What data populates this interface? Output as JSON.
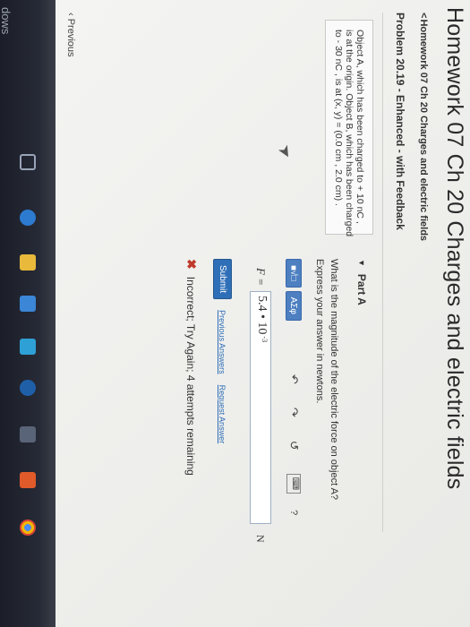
{
  "os": {
    "taskbar_label": "dows"
  },
  "page": {
    "title": "Homework 07 Ch 20 Charges and electric fields",
    "breadcrumb": "Homework 07 Ch 20 Charges and electric fields",
    "problem": "Problem 20.19 - Enhanced - with Feedback"
  },
  "problem_text": {
    "line1": "Object A, which has been charged to + 10 nC ,",
    "line2": "is at the origin. Object B, which has been charged",
    "line3": "to - 30 nC , is at (x, y) = (0.0 cm , 2.0 cm) ."
  },
  "part": {
    "label": "Part A",
    "question": "What is the magnitude of the electric force on object A?",
    "instruction": "Express your answer in newtons."
  },
  "toolbar": {
    "template_btn": "■√□",
    "symbols_btn": "AΣφ",
    "keyboard_icon": "⌨",
    "help": "?"
  },
  "answer": {
    "variable": "F =",
    "value": "5.4 • 10",
    "exponent": "-3",
    "unit": "N"
  },
  "actions": {
    "submit": "Submit",
    "previous_answers": "Previous Answers",
    "request_answer": "Request Answer"
  },
  "feedback": {
    "text": "Incorrect; Try Again; 4 attempts remaining"
  },
  "nav": {
    "previous": "‹ Previous"
  }
}
